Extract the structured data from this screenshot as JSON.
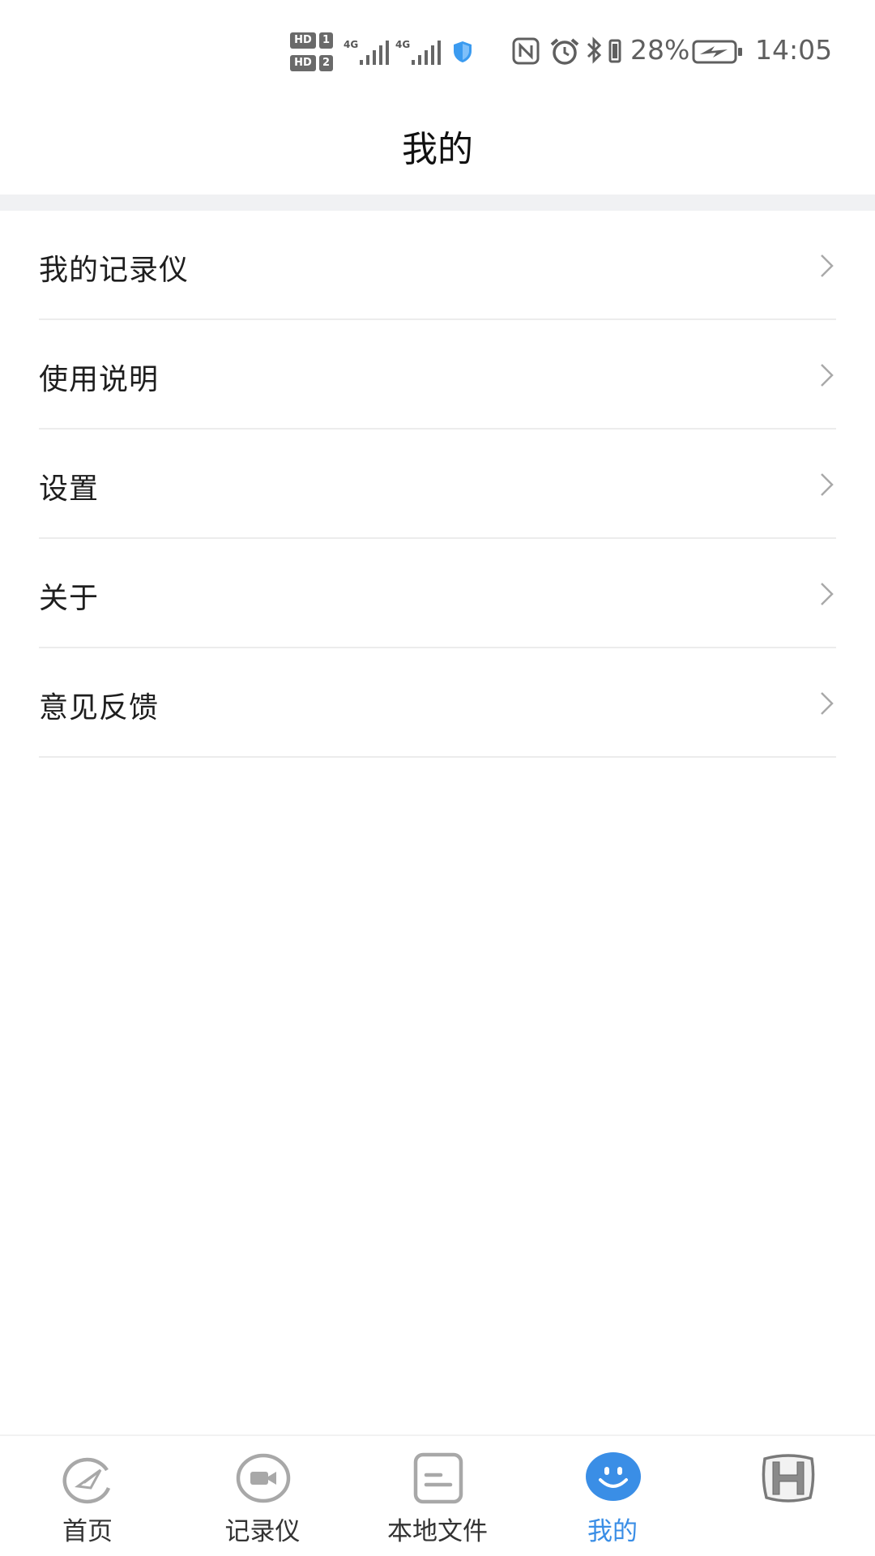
{
  "status_bar": {
    "hd1_label": "HD",
    "hd1_num": "1",
    "hd2_label": "HD",
    "hd2_num": "2",
    "signal1_tag": "4G",
    "signal2_tag": "4G",
    "battery_percent": "28%",
    "time": "14:05",
    "icons": [
      "hd-icon",
      "signal-icon",
      "shield-icon",
      "nfc-icon",
      "alarm-icon",
      "bluetooth-icon",
      "vibrate-icon",
      "battery-charging-icon"
    ],
    "shield_color": "#3b9bf0"
  },
  "header": {
    "title": "我的"
  },
  "menu": {
    "items": [
      {
        "label": "我的记录仪"
      },
      {
        "label": "使用说明"
      },
      {
        "label": "设置"
      },
      {
        "label": "关于"
      },
      {
        "label": "意见反馈"
      }
    ],
    "chevron_icon": "chevron-right-icon"
  },
  "tabs": {
    "items": [
      {
        "label": "首页",
        "icon": "compass-icon",
        "active": false
      },
      {
        "label": "记录仪",
        "icon": "video-camera-icon",
        "active": false
      },
      {
        "label": "本地文件",
        "icon": "file-icon",
        "active": false
      },
      {
        "label": "我的",
        "icon": "smiley-icon",
        "active": true
      },
      {
        "label": "",
        "icon": "honda-logo-icon",
        "active": false
      }
    ],
    "active_color": "#3a8ee6",
    "inactive_color": "#333333"
  }
}
